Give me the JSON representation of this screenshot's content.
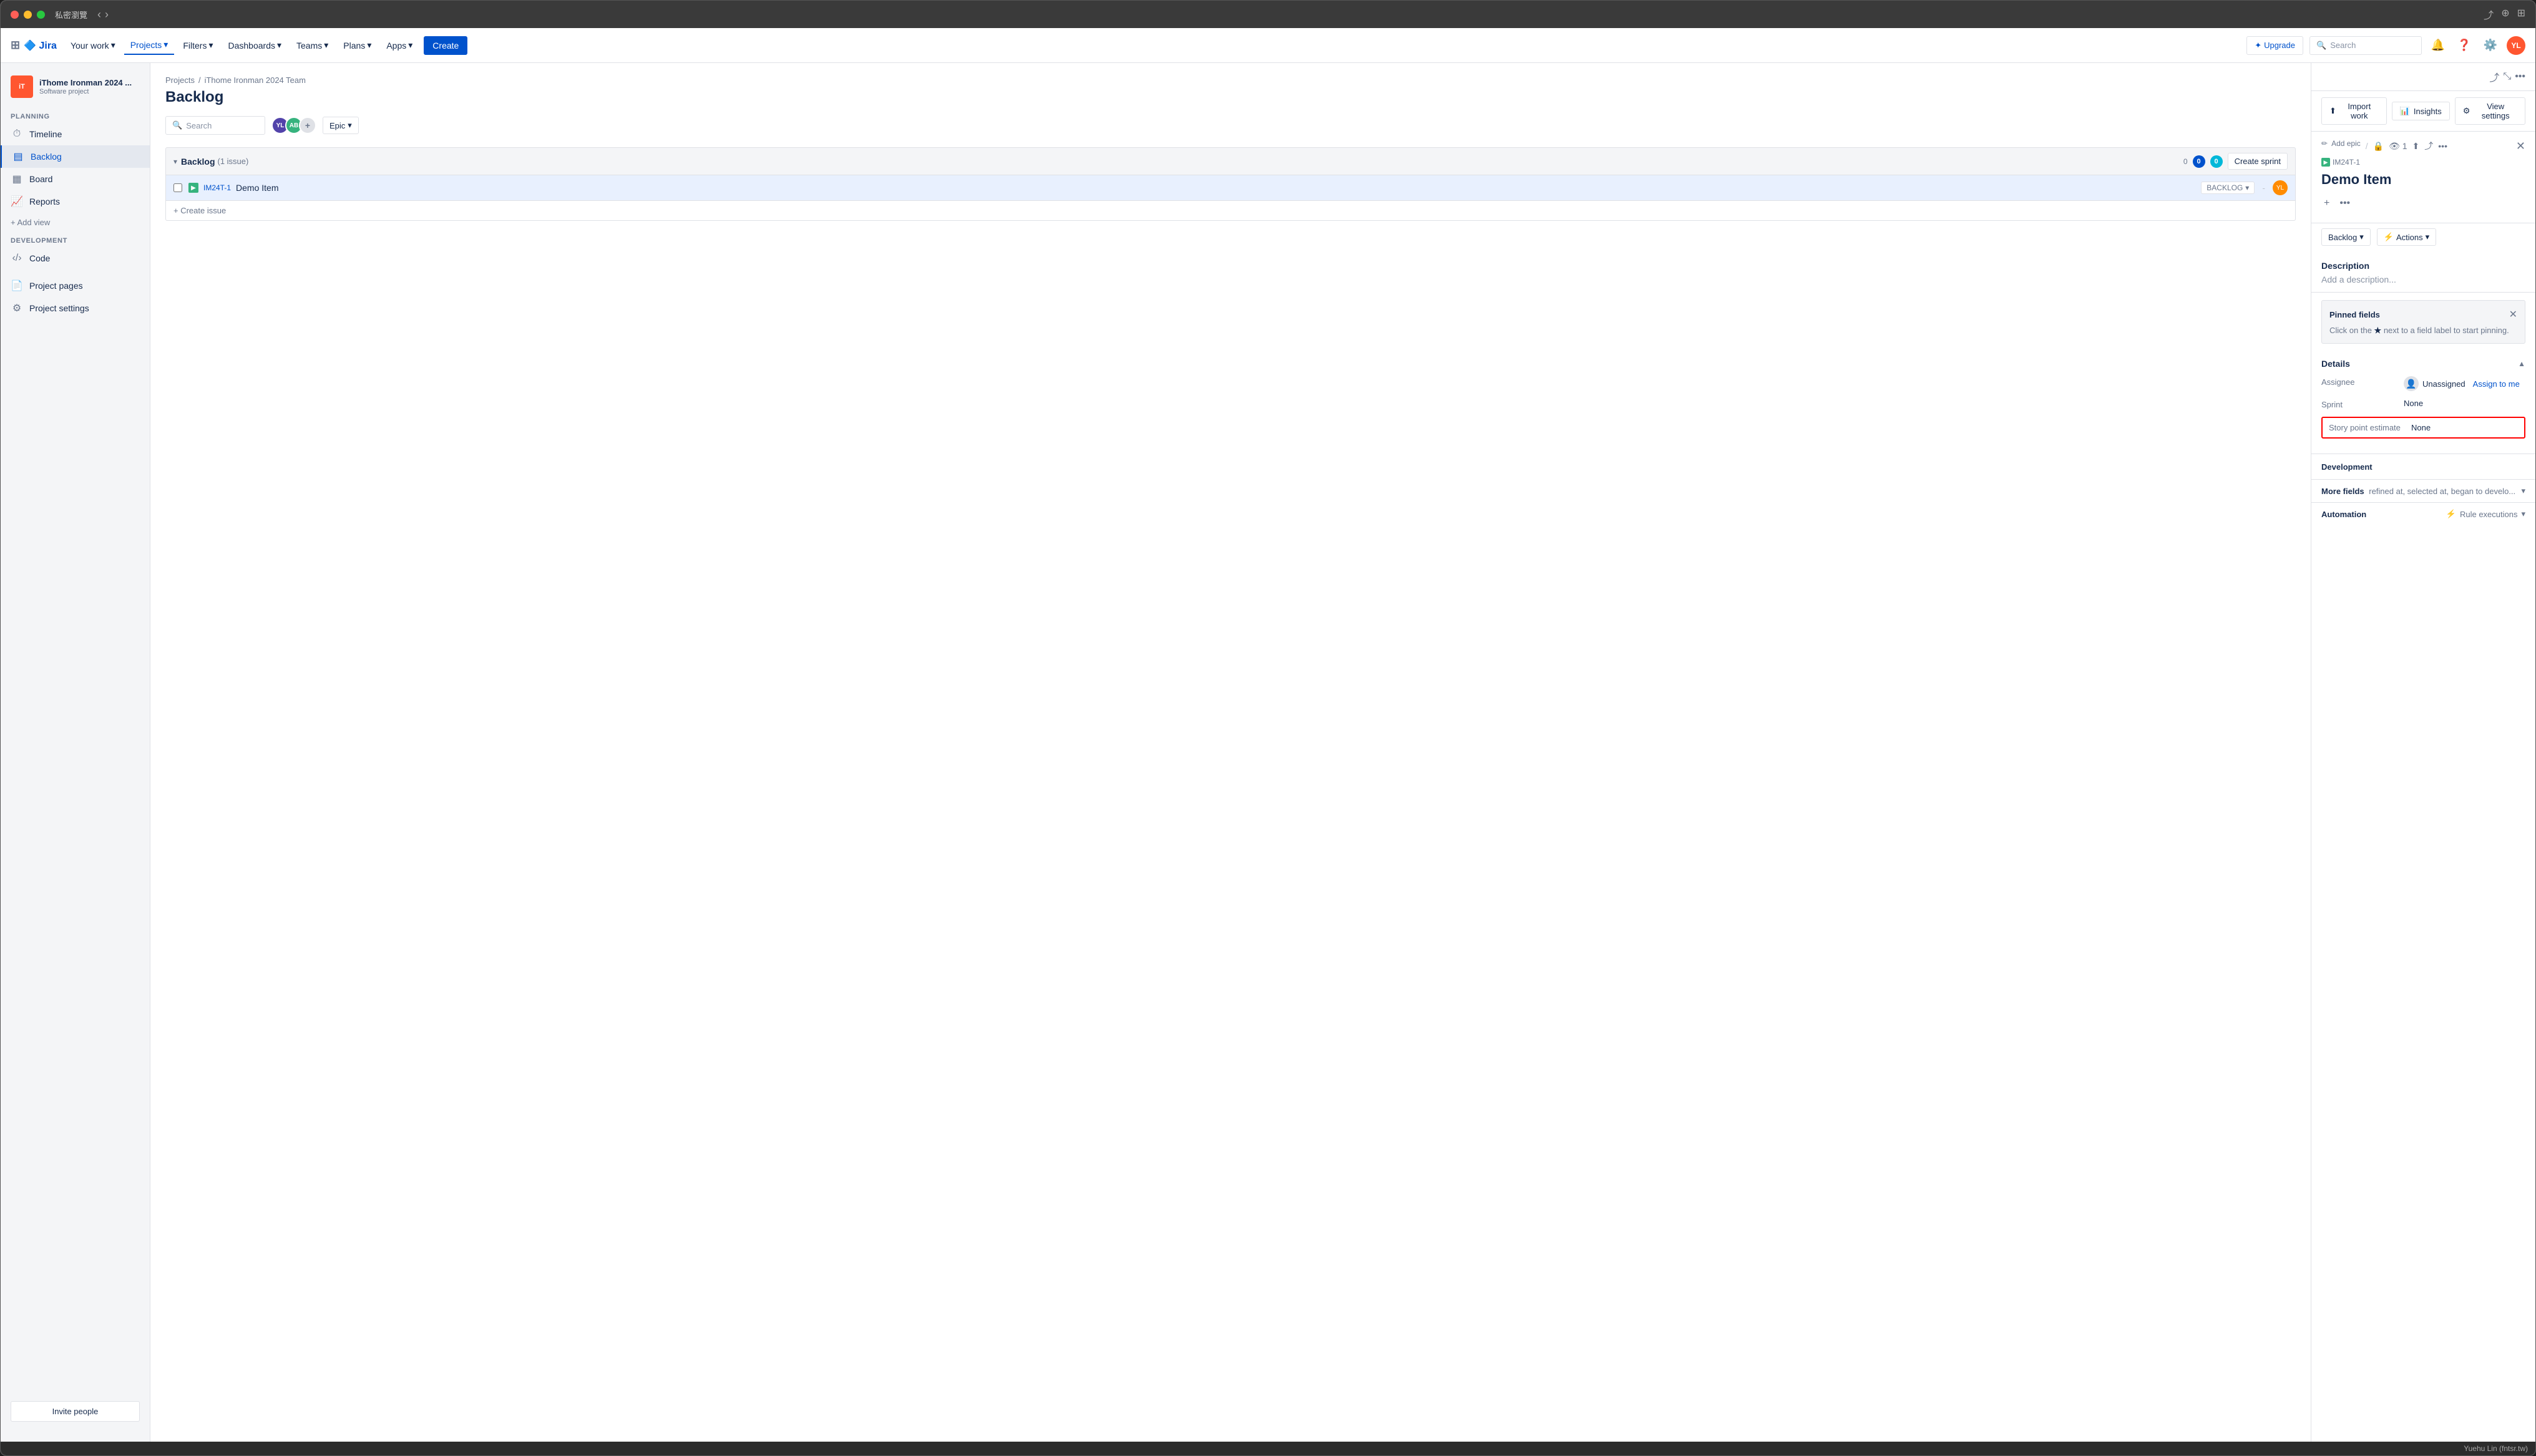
{
  "window": {
    "title": "私密瀏覽",
    "tl_red": "#ff5f57",
    "tl_yellow": "#febc2e",
    "tl_green": "#28c840"
  },
  "topnav": {
    "logo": "Jira",
    "items": [
      {
        "label": "Your work",
        "dropdown": true,
        "active": false
      },
      {
        "label": "Projects",
        "dropdown": true,
        "active": true
      },
      {
        "label": "Filters",
        "dropdown": true,
        "active": false
      },
      {
        "label": "Dashboards",
        "dropdown": true,
        "active": false
      },
      {
        "label": "Teams",
        "dropdown": true,
        "active": false
      },
      {
        "label": "Plans",
        "dropdown": true,
        "active": false
      },
      {
        "label": "Apps",
        "dropdown": true,
        "active": false
      }
    ],
    "create_label": "Create",
    "upgrade_label": "Upgrade",
    "search_placeholder": "Search",
    "user_initials": "YL"
  },
  "sidebar": {
    "project_name": "iThome Ironman 2024 ...",
    "project_type": "Software project",
    "sections": [
      {
        "label": "PLANNING",
        "items": [
          {
            "label": "Timeline",
            "icon": "timeline"
          },
          {
            "label": "Backlog",
            "icon": "backlog",
            "active": true
          },
          {
            "label": "Board",
            "icon": "board"
          },
          {
            "label": "Reports",
            "icon": "reports"
          }
        ]
      },
      {
        "label": "DEVELOPMENT",
        "items": [
          {
            "label": "Code",
            "icon": "code"
          }
        ]
      },
      {
        "items": [
          {
            "label": "Project pages",
            "icon": "pages"
          },
          {
            "label": "Project settings",
            "icon": "settings"
          }
        ]
      }
    ],
    "add_view_label": "+ Add view",
    "invite_label": "Invite people"
  },
  "breadcrumb": {
    "items": [
      "Projects",
      "iThome Ironman 2024 Team"
    ],
    "separator": "/"
  },
  "page_title": "Backlog",
  "toolbar": {
    "search_placeholder": "Search",
    "epic_label": "Epic"
  },
  "backlog_section": {
    "title": "Backlog",
    "count_label": "(1 issue)",
    "badge_zero": "0",
    "badge_zero2": "0",
    "badge_teal_value": "0",
    "create_sprint_label": "Create sprint",
    "issues": [
      {
        "id": "IM24T-1",
        "title": "Demo Item",
        "status": "BACKLOG",
        "assignee_initials": "YL",
        "priority": "-"
      }
    ],
    "create_issue_label": "+ Create issue"
  },
  "right_panel": {
    "import_label": "Import work",
    "insights_label": "Insights",
    "view_settings_label": "View settings",
    "add_epic_label": "Add epic",
    "issue_key": "IM24T-1",
    "issue_title": "Demo Item",
    "backlog_status": "Backlog",
    "actions_label": "Actions",
    "description_label": "Description",
    "description_placeholder": "Add a description...",
    "pinned_fields": {
      "title": "Pinned fields",
      "text": "Click on the",
      "icon_hint": "★",
      "text2": "next to a field label to start pinning."
    },
    "details_label": "Details",
    "assignee_label": "Assignee",
    "assignee_value": "Unassigned",
    "assign_me_label": "Assign to me",
    "sprint_label": "Sprint",
    "sprint_value": "None",
    "story_point_label": "Story point estimate",
    "story_point_value": "None",
    "development_label": "Development",
    "more_fields_label": "More fields",
    "more_fields_detail": "refined at, selected at, began to develo...",
    "automation_label": "Automation",
    "rule_executions_label": "Rule executions"
  }
}
